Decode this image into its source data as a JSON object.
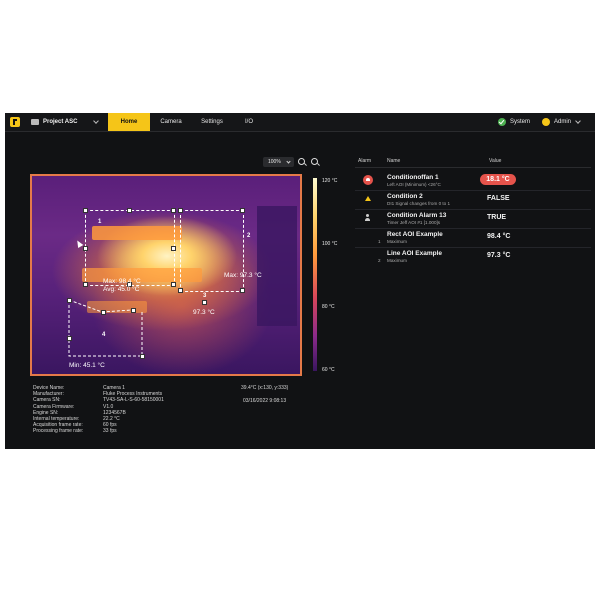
{
  "topbar": {
    "project_label": "Project ASC",
    "tabs": [
      {
        "label": "Home",
        "active": true
      },
      {
        "label": "Camera",
        "active": false
      },
      {
        "label": "Settings",
        "active": false
      },
      {
        "label": "I/O",
        "active": false
      }
    ],
    "system_label": "System",
    "user_label": "Admin"
  },
  "camera_view": {
    "zoom_value": "100%",
    "scale_labels": [
      "120 °C",
      "100 °C",
      "80 °C",
      "60 °C"
    ],
    "aoi_labels": [
      "1",
      "2",
      "3",
      "4"
    ],
    "rect_text_top": "Max: 98.4 °C",
    "rect_text_avg": "Avg: 45.0 °C",
    "max_text": "Max: 97.3 °C",
    "spot_text": "97.3 °C",
    "min_text": "Min: 45.1 °C"
  },
  "device_info": {
    "fields": [
      {
        "label": "Device Name:",
        "value": "Camera 1"
      },
      {
        "label": "Manufacturer:",
        "value": "Fluke Process Instruments"
      },
      {
        "label": "Camera SN:",
        "value": "TV43-SA-L-S-60-58150001"
      },
      {
        "label": "Camera Firmware:",
        "value": "V1.0"
      },
      {
        "label": "Engine SN:",
        "value": "1234567B"
      },
      {
        "label": "Internal temperature:",
        "value": "22.2 °C"
      },
      {
        "label": "Acquisition frame rate:",
        "value": "60 fps"
      },
      {
        "label": "Processing frame rate:",
        "value": "33 fps"
      }
    ],
    "cursor_readout": "39.4°C (x:130, y:333)",
    "timestamp": "03/16/2022 9:08:13"
  },
  "alarm_panel": {
    "headers": {
      "alarm": "Alarm",
      "name": "Name",
      "value": "Value"
    },
    "rows": [
      {
        "index": "",
        "name": "Conditionoffan 1",
        "sub": "Left AOI (Minimum) <26°C",
        "value": "18.1 °C",
        "alarm": "red",
        "highlight": true
      },
      {
        "index": "",
        "name": "Condition 2",
        "sub": "DI1 Signal changes from 0 to 1",
        "value": "FALSE",
        "alarm": "bell",
        "highlight": false
      },
      {
        "index": "",
        "name": "Condition Alarm 13",
        "sub": "Timer Jeff AOI #1 [1.000]s",
        "value": "TRUE",
        "alarm": "person",
        "highlight": false
      },
      {
        "index": "1",
        "name": "Rect AOI Example",
        "sub": "Maximum",
        "value": "98.4 °C",
        "alarm": "",
        "highlight": false
      },
      {
        "index": "2",
        "name": "Line AOI Example",
        "sub": "Maximum",
        "value": "97.3 °C",
        "alarm": "",
        "highlight": false
      }
    ]
  },
  "colors": {
    "accent": "#f5c518",
    "alarm_red": "#e5534b",
    "background": "#111214"
  }
}
